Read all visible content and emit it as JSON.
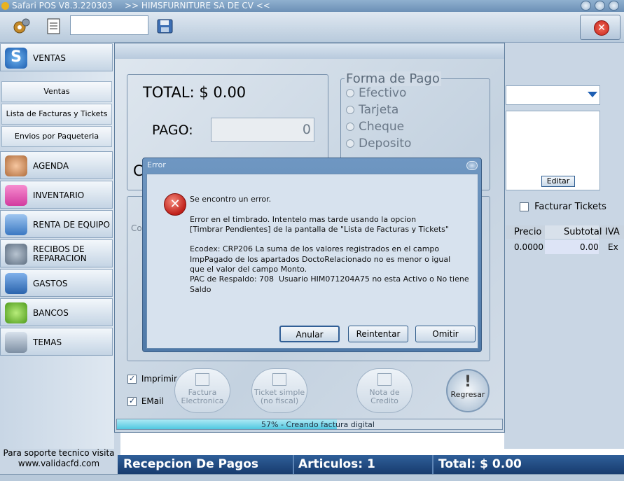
{
  "window": {
    "app_title": "Safari POS V8.3.220303",
    "company": ">> HIMSFURNITURE SA DE CV <<"
  },
  "toolbar": {
    "icons": [
      "gear-icon",
      "document-icon",
      "save-disk-icon",
      "close-icon"
    ],
    "search_value": ""
  },
  "sidebar": {
    "ventas_label": "VENTAS",
    "sub_items": [
      "Ventas",
      "Lista de Facturas y Tickets",
      "Envios por Paqueteria"
    ],
    "items": [
      {
        "label": "AGENDA",
        "icon": "agenda-person-icon"
      },
      {
        "label": "INVENTARIO",
        "icon": "inventory-box-icon"
      },
      {
        "label": "RENTA DE EQUIPO",
        "icon": "rental-notepad-icon"
      },
      {
        "label": "RECIBOS DE REPARACION",
        "icon": "repair-tools-icon"
      },
      {
        "label": "GASTOS",
        "icon": "credit-card-icon"
      },
      {
        "label": "BANCOS",
        "icon": "piggy-bank-icon"
      },
      {
        "label": "TEMAS",
        "icon": "monitor-icon"
      }
    ],
    "support_line1": "Para soporte tecnico visita",
    "support_line2": "www.validacfd.com"
  },
  "payment": {
    "total_label": "TOTAL: $ 0.00",
    "pago_label": "PAGO:",
    "pago_value": "0",
    "cambio_partial": "C",
    "forma_pago_label": "Forma de Pago",
    "forma_pago_options": [
      "Efectivo",
      "Tarjeta",
      "Cheque",
      "Deposito"
    ],
    "co_label": "Co",
    "imprimir_label": "Imprimir",
    "email_label": "EMail",
    "btn_factura": "Factura Electronica",
    "btn_ticket": "Ticket simple (no fiscal)",
    "btn_nota": "Nota de Credito",
    "btn_regresar": "Regresar",
    "progress_percent": 57,
    "progress_text": "57% - Creando factura digital"
  },
  "error_dialog": {
    "title": "Error",
    "message": "Se encontro un error.\n\nError en el timbrado. Intentelo mas tarde usando la opcion\n[Timbrar Pendientes] de la pantalla de \"Lista de Facturas y Tickets\"\n\nEcodex: CRP206 La suma de los valores registrados en el campo\nImpPagado de los apartados DoctoRelacionado no es menor o igual\nque el valor del campo Monto.\nPAC de Respaldo: 708  Usuario HIM071204A75 no esta Activo o No tiene\nSaldo",
    "btn_anular": "Anular",
    "btn_reintentar": "Reintentar",
    "btn_omitir": "Omitir"
  },
  "right_panel": {
    "editar_label": "Editar",
    "facturar_tickets_label": "Facturar Tickets",
    "grid_headers": [
      "Precio",
      "Subtotal",
      "IVA"
    ],
    "grid_row": [
      "0.0000",
      "0.00",
      "Ex"
    ]
  },
  "status_bar": {
    "mode": "Recepcion De Pagos",
    "articulos": "Articulos: 1",
    "total": "Total: $ 0.00"
  }
}
